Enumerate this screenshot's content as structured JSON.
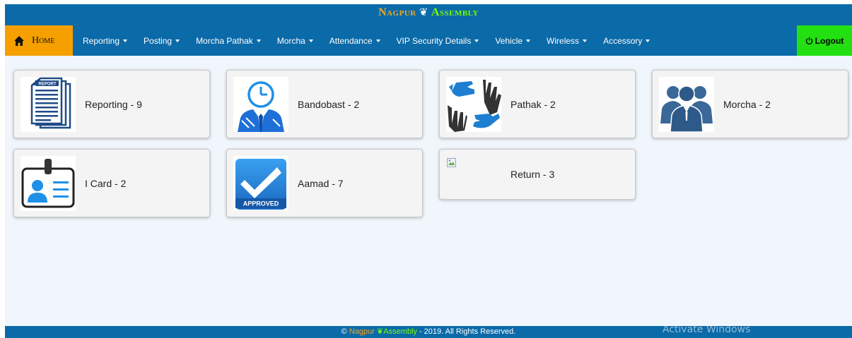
{
  "brand": {
    "part1": "Nagpur",
    "separator": "❦",
    "part2": "Assembly"
  },
  "nav": {
    "home_label": "Home",
    "items": [
      {
        "label": "Reporting"
      },
      {
        "label": "Posting"
      },
      {
        "label": "Morcha Pathak"
      },
      {
        "label": "Morcha"
      },
      {
        "label": "Attendance"
      },
      {
        "label": "VIP Security Details"
      },
      {
        "label": "Vehicle"
      },
      {
        "label": "Wireless"
      },
      {
        "label": "Accessory"
      }
    ],
    "logout_label": "Logout"
  },
  "tiles": [
    {
      "label": "Reporting - 9",
      "icon": "report-document-icon"
    },
    {
      "label": "Bandobast - 2",
      "icon": "clock-person-icon"
    },
    {
      "label": "Pathak - 2",
      "icon": "gloves-icon"
    },
    {
      "label": "Morcha - 2",
      "icon": "group-people-icon"
    },
    {
      "label": "I Card - 2",
      "icon": "id-card-icon"
    },
    {
      "label": "Aamad - 7",
      "icon": "approved-check-icon",
      "badge": "APPROVED"
    },
    {
      "label": "Return - 3",
      "icon": "broken-image-icon"
    }
  ],
  "footer": {
    "copyright": "©",
    "part1": "Nagpur",
    "separator": "❦",
    "part2": "Assembly",
    "rest": "- 2019. All Rights Reserved."
  },
  "watermark": "Activate Windows",
  "colors": {
    "header": "#0b6aa8",
    "home": "#f5a000",
    "logout": "#22e011",
    "brand_orange": "#f5a623",
    "brand_green": "#7cfc00"
  }
}
